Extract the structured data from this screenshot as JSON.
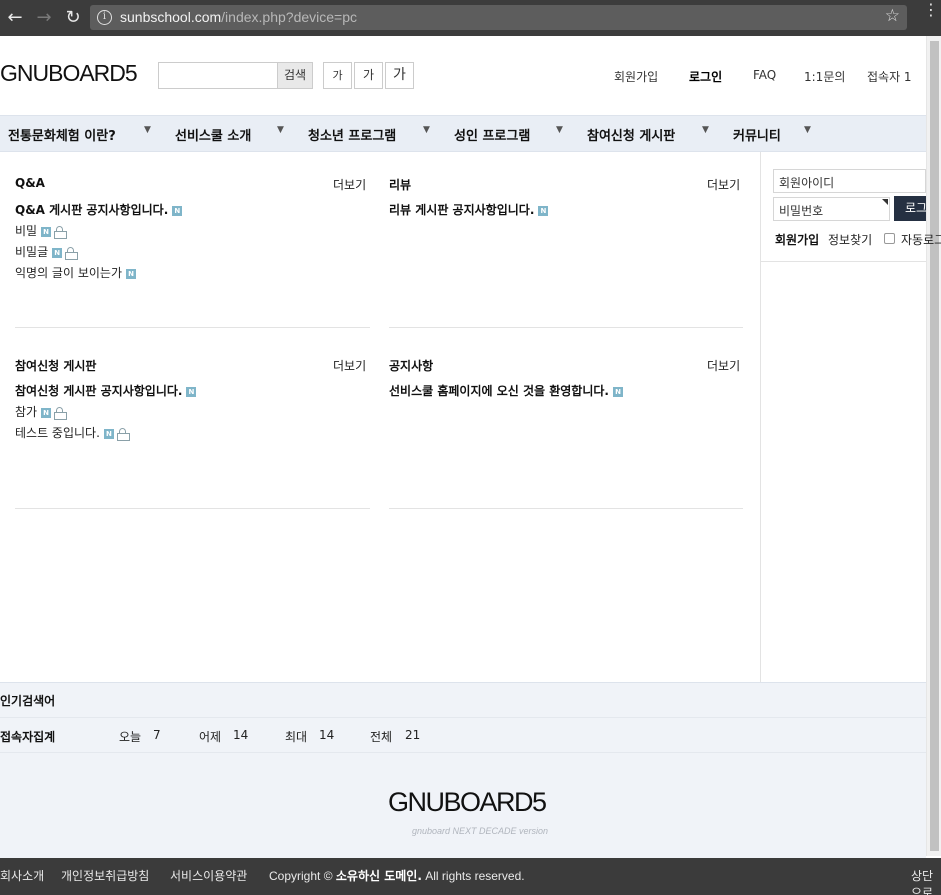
{
  "browser": {
    "url_host": "sunbschool.com",
    "url_path": "/index.php?device=pc"
  },
  "header": {
    "logo": "GNUBOARD5",
    "search_button": "검색",
    "font_small": "가",
    "font_medium": "가",
    "font_large": "가",
    "links": [
      "회원가입",
      "로그인",
      "FAQ",
      "1:1문의",
      "접속자 1"
    ]
  },
  "gnb": {
    "items": [
      "전통문화체험 이란?",
      "선비스쿨 소개",
      "청소년 프로그램",
      "성인 프로그램",
      "참여신청 게시판",
      "커뮤니티"
    ]
  },
  "latest": {
    "more_label": "더보기",
    "boards": [
      {
        "title": "Q&A",
        "notice": "Q&A 게시판 공지사항입니다.",
        "posts": [
          {
            "subject": "비밀",
            "secret": true
          },
          {
            "subject": "비밀글",
            "secret": true
          },
          {
            "subject": "익명의 글이 보이는가",
            "secret": false
          }
        ]
      },
      {
        "title": "리뷰",
        "notice": "리뷰 게시판 공지사항입니다.",
        "posts": []
      },
      {
        "title": "참여신청 게시판",
        "notice": "참여신청 게시판 공지사항입니다.",
        "posts": [
          {
            "subject": "참가",
            "secret": true
          },
          {
            "subject": "테스트 중입니다.",
            "secret": true
          }
        ]
      },
      {
        "title": "공지사항",
        "notice": "선비스쿨 홈페이지에 오신 것을 환영합니다.",
        "posts": []
      }
    ],
    "new_badge": "N"
  },
  "outlogin": {
    "id_placeholder": "회원아이디",
    "pw_placeholder": "비밀번호",
    "submit": "로그인",
    "join": "회원가입",
    "find": "정보찾기",
    "auto_login": "자동로그인"
  },
  "popular": {
    "title": "인기검색어"
  },
  "visit": {
    "title": "접속자집계",
    "today_label": "오늘",
    "today": "7",
    "yesterday_label": "어제",
    "yesterday": "14",
    "max_label": "최대",
    "max": "14",
    "total_label": "전체",
    "total": "21"
  },
  "footer": {
    "logo": "GNUBOARD5",
    "tagline": "gnuboard NEXT DECADE version",
    "links": [
      "회사소개",
      "개인정보취급방침",
      "서비스이용약관"
    ],
    "copyright_pre": "Copyright © ",
    "copyright_owner": "소유하신 도메인.",
    "copyright_post": " All rights reserved.",
    "top_button": "상단으로"
  }
}
